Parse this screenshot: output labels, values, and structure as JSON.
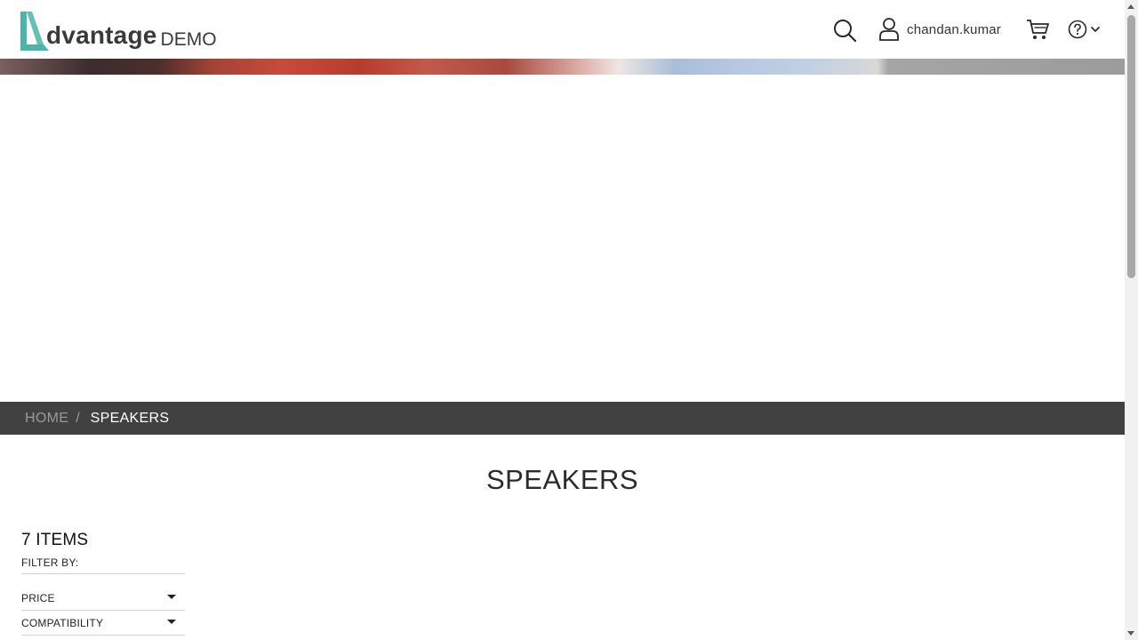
{
  "header": {
    "logo_word": "dvantage",
    "logo_sub": "DEMO",
    "user_name": "chandan.kumar",
    "icons": {
      "search": "search-icon",
      "user": "user-icon",
      "cart": "cart-icon",
      "help": "help-icon",
      "menu": "chevron-down-icon"
    }
  },
  "breadcrumb": {
    "home": "HOME",
    "separator": "/",
    "current": "SPEAKERS"
  },
  "page_title": "SPEAKERS",
  "sidebar": {
    "items_count": "7 ITEMS",
    "filter_by": "FILTER BY:",
    "filters": [
      {
        "label": "PRICE"
      },
      {
        "label": "COMPATIBILITY"
      }
    ]
  },
  "colors": {
    "brand_teal": "#4cb5ab",
    "breadcrumb_bg": "#414141",
    "text_dark": "#222222"
  }
}
